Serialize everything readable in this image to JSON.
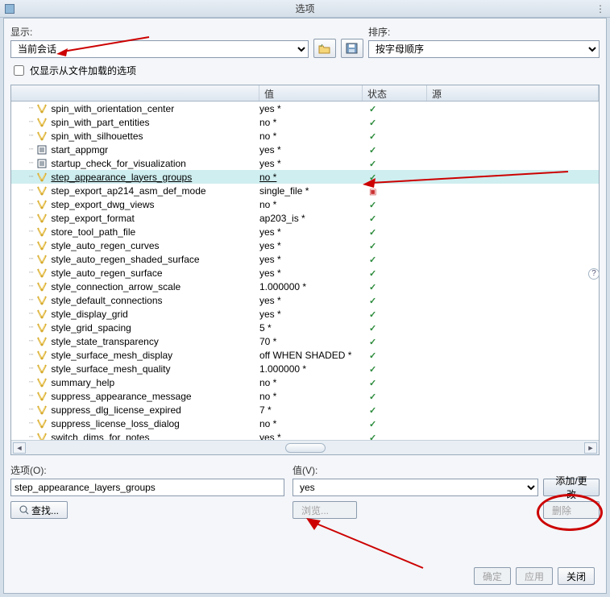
{
  "title": "选项",
  "display_label": "显示:",
  "display_value": "当前会话",
  "sort_label": "排序:",
  "sort_value": "按字母顺序",
  "checkbox_label": "仅显示从文件加载的选项",
  "columns": {
    "name": "",
    "value": "值",
    "status": "状态",
    "source": "源"
  },
  "rows": [
    {
      "name": "spin_with_orientation_center",
      "value": "yes *",
      "icon": "lt",
      "stat": "g"
    },
    {
      "name": "spin_with_part_entities",
      "value": "no *",
      "icon": "lt",
      "stat": "g"
    },
    {
      "name": "spin_with_silhouettes",
      "value": "no *",
      "icon": "lt",
      "stat": "g"
    },
    {
      "name": "start_appmgr",
      "value": "yes *",
      "icon": "sq",
      "stat": "g"
    },
    {
      "name": "startup_check_for_visualization",
      "value": "yes *",
      "icon": "sq",
      "stat": "g"
    },
    {
      "name": "step_appearance_layers_groups",
      "value": "no *",
      "icon": "lt",
      "stat": "g",
      "sel": true
    },
    {
      "name": "step_export_ap214_asm_def_mode",
      "value": "single_file *",
      "icon": "lt",
      "stat": "r"
    },
    {
      "name": "step_export_dwg_views",
      "value": "no *",
      "icon": "lt",
      "stat": "g"
    },
    {
      "name": "step_export_format",
      "value": "ap203_is *",
      "icon": "lt",
      "stat": "g"
    },
    {
      "name": "store_tool_path_file",
      "value": "yes *",
      "icon": "lt",
      "stat": "g"
    },
    {
      "name": "style_auto_regen_curves",
      "value": "yes *",
      "icon": "lt",
      "stat": "g"
    },
    {
      "name": "style_auto_regen_shaded_surface",
      "value": "yes *",
      "icon": "lt",
      "stat": "g"
    },
    {
      "name": "style_auto_regen_surface",
      "value": "yes *",
      "icon": "lt",
      "stat": "g"
    },
    {
      "name": "style_connection_arrow_scale",
      "value": "1.000000 *",
      "icon": "lt",
      "stat": "g"
    },
    {
      "name": "style_default_connections",
      "value": "yes *",
      "icon": "lt",
      "stat": "g"
    },
    {
      "name": "style_display_grid",
      "value": "yes *",
      "icon": "lt",
      "stat": "g"
    },
    {
      "name": "style_grid_spacing",
      "value": "5 *",
      "icon": "lt",
      "stat": "g"
    },
    {
      "name": "style_state_transparency",
      "value": "70 *",
      "icon": "lt",
      "stat": "g"
    },
    {
      "name": "style_surface_mesh_display",
      "value": "off WHEN SHADED *",
      "icon": "lt",
      "stat": "g"
    },
    {
      "name": "style_surface_mesh_quality",
      "value": "1.000000 *",
      "icon": "lt",
      "stat": "g"
    },
    {
      "name": "summary_help",
      "value": "no *",
      "icon": "lt",
      "stat": "g"
    },
    {
      "name": "suppress_appearance_message",
      "value": "no *",
      "icon": "lt",
      "stat": "g"
    },
    {
      "name": "suppress_dlg_license_expired",
      "value": "7 *",
      "icon": "lt",
      "stat": "g"
    },
    {
      "name": "suppress_license_loss_dialog",
      "value": "no *",
      "icon": "lt",
      "stat": "g"
    },
    {
      "name": "switch_dims_for_notes",
      "value": "yes *",
      "icon": "lt",
      "stat": "g"
    }
  ],
  "option_label": "选项(O):",
  "option_value": "step_appearance_layers_groups",
  "value_label": "值(V):",
  "value_value": "yes",
  "find_label": "查找...",
  "browse_label": "浏览...",
  "add_change_label": "添加/更改",
  "delete_label": "删除",
  "ok_label": "确定",
  "apply_label": "应用",
  "close_label": "关闭"
}
